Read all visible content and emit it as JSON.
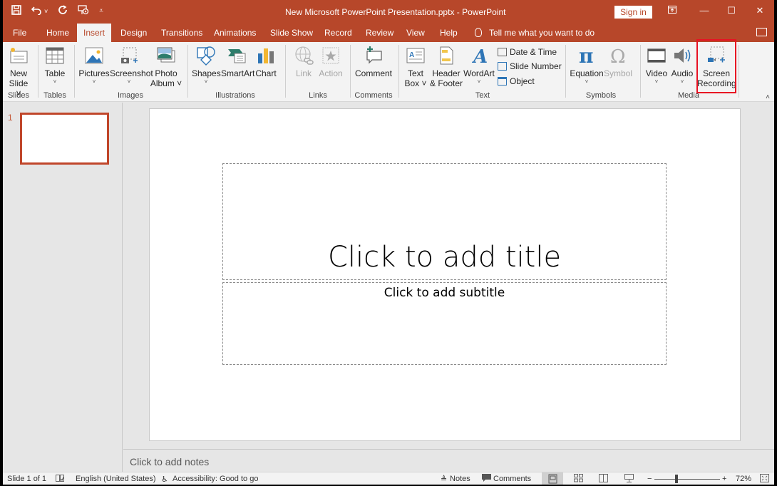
{
  "window": {
    "title": "New Microsoft PowerPoint Presentation.pptx  -  PowerPoint",
    "sign_in": "Sign in",
    "restore_icon": "ribbon-display-icon",
    "minimize": "—",
    "maximize": "☐",
    "close": "✕"
  },
  "qat": {
    "save": "save-icon",
    "undo": "undo-icon",
    "undo_more": "chevron-down-icon",
    "redo": "redo-icon",
    "present": "present-from-beginning-icon",
    "customize": "customize-qat-icon"
  },
  "tabs": [
    {
      "label": "File",
      "active": false
    },
    {
      "label": "Home",
      "active": false
    },
    {
      "label": "Insert",
      "active": true
    },
    {
      "label": "Design",
      "active": false
    },
    {
      "label": "Transitions",
      "active": false
    },
    {
      "label": "Animations",
      "active": false
    },
    {
      "label": "Slide Show",
      "active": false
    },
    {
      "label": "Record",
      "active": false
    },
    {
      "label": "Review",
      "active": false
    },
    {
      "label": "View",
      "active": false
    },
    {
      "label": "Help",
      "active": false
    }
  ],
  "tell_me": "Tell me what you want to do",
  "ribbon": {
    "groups": {
      "slides": "Slides",
      "tables": "Tables",
      "images": "Images",
      "illustrations": "Illustrations",
      "links": "Links",
      "comments": "Comments",
      "text": "Text",
      "symbols": "Symbols",
      "media": "Media"
    },
    "buttons": {
      "new_slide": [
        "New",
        "Slide ˅"
      ],
      "table": [
        "Table"
      ],
      "pictures": [
        "Pictures"
      ],
      "screenshot": [
        "Screenshot"
      ],
      "photo_album": [
        "Photo",
        "Album ˅"
      ],
      "shapes": [
        "Shapes"
      ],
      "smartart": [
        "SmartArt"
      ],
      "chart": [
        "Chart"
      ],
      "link": [
        "Link"
      ],
      "action": [
        "Action"
      ],
      "comment": [
        "Comment"
      ],
      "text_box": [
        "Text",
        "Box ˅"
      ],
      "header_footer": [
        "Header",
        "& Footer"
      ],
      "wordart": [
        "WordArt"
      ],
      "date_time": "Date & Time",
      "slide_number": "Slide Number",
      "object": "Object",
      "equation": [
        "Equation"
      ],
      "symbol": [
        "Symbol"
      ],
      "video": [
        "Video"
      ],
      "audio": [
        "Audio"
      ],
      "screen_recording": [
        "Screen",
        "Recording"
      ]
    },
    "highlighted_button": "Screen Recording"
  },
  "slides_pane": {
    "slides": [
      {
        "number": "1"
      }
    ]
  },
  "slide": {
    "title_placeholder": "Click to add title",
    "subtitle_placeholder": "Click to add subtitle"
  },
  "notes": {
    "placeholder": "Click to add notes"
  },
  "status": {
    "slide_info": "Slide 1 of 1",
    "language": "English (United States)",
    "accessibility": "Accessibility: Good to go",
    "notes": "Notes",
    "comments": "Comments",
    "zoom_minus": "−",
    "zoom_plus": "+",
    "zoom_level": "72%",
    "zoom_fraction": 0.72
  },
  "colors": {
    "accent": "#b7472a",
    "highlight": "#e81123"
  }
}
